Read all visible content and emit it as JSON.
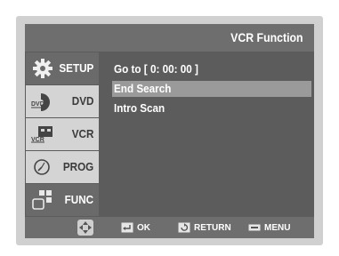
{
  "header": {
    "title": "VCR Function"
  },
  "sidebar": {
    "items": [
      {
        "label": "SETUP",
        "icon": "gear-icon",
        "active": true
      },
      {
        "label": "DVD",
        "icon": "dvd-disc-icon",
        "icon_text": "DVD",
        "active": false
      },
      {
        "label": "VCR",
        "icon": "vcr-tape-icon",
        "icon_text": "VCR",
        "active": false
      },
      {
        "label": "PROG",
        "icon": "clock-icon",
        "active": false
      },
      {
        "label": "FUNC",
        "icon": "function-icon",
        "active": true
      }
    ]
  },
  "menu": {
    "items": [
      {
        "label": "Go to  [ 0: 00: 00 ]",
        "selected": false
      },
      {
        "label": "End Search",
        "selected": true
      },
      {
        "label": "Intro Scan",
        "selected": false
      }
    ]
  },
  "footer": {
    "ok_label": "OK",
    "return_label": "RETURN",
    "menu_label": "MENU"
  },
  "colors": {
    "panel_bg": "#5c5c5c",
    "header_bg": "#6e6e6e",
    "highlight": "#9a9a9a",
    "inactive_tab": "#d4d4d4",
    "frame": "#d0d0d0"
  }
}
